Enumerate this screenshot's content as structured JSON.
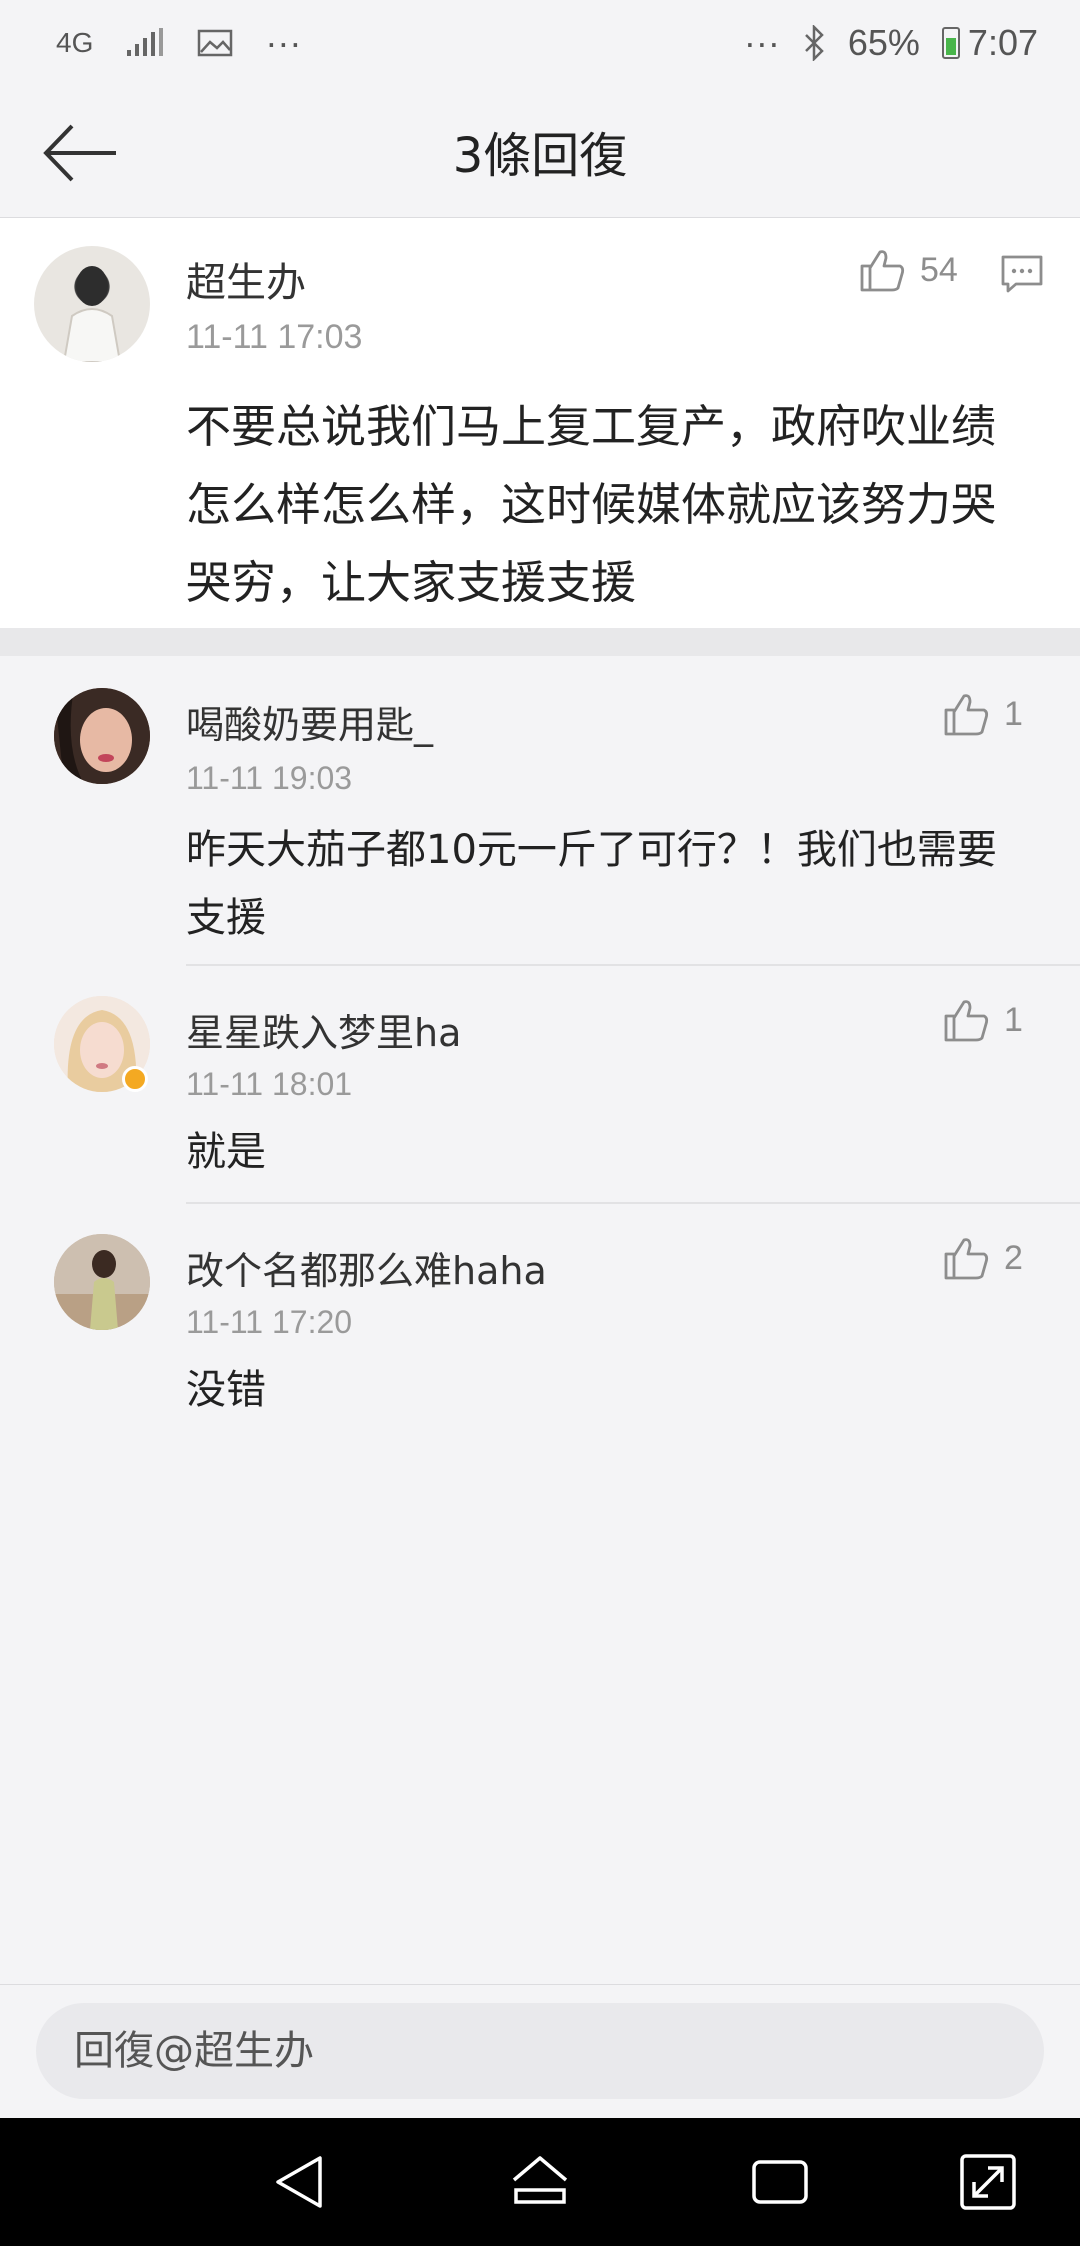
{
  "status_bar": {
    "network": "4G",
    "battery": "65%",
    "time": "7:07",
    "icons": [
      "signal-icon",
      "gallery-icon",
      "more-dots-icon",
      "bluetooth-icon",
      "battery-icon"
    ]
  },
  "header": {
    "title": "3條回復",
    "back_icon": "arrow-left-icon"
  },
  "main_comment": {
    "username": "超生办",
    "time": "11-11 17:03",
    "likes": "54",
    "text": "不要总说我们马上复工复产，政府吹业绩怎么样怎么样，这时候媒体就应该努力哭哭穷，让大家支援支援"
  },
  "replies": [
    {
      "username": "喝酸奶要用匙_",
      "time": "11-11 19:03",
      "likes": "1",
      "text": "昨天大茄子都10元一斤了可行？！我们也需要支援"
    },
    {
      "username": "星星跌入梦里ha",
      "time": "11-11 18:01",
      "likes": "1",
      "text": "就是",
      "verified": true
    },
    {
      "username": "改个名都那么难haha",
      "time": "11-11 17:20",
      "likes": "2",
      "text": "没错"
    }
  ],
  "input": {
    "placeholder": "回復@超生办"
  },
  "colors": {
    "background": "#f4f4f6",
    "card": "#ffffff",
    "muted": "#9a9a9a",
    "verified": "#f4a922"
  }
}
